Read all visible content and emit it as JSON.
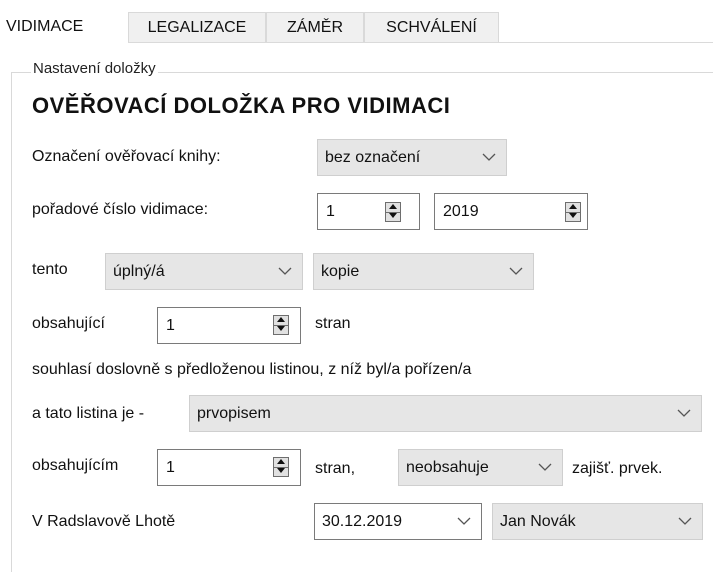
{
  "tabs": [
    {
      "label": "VIDIMACE",
      "active": true
    },
    {
      "label": "LEGALIZACE",
      "active": false
    },
    {
      "label": "ZÁMĚR",
      "active": false
    },
    {
      "label": "SCHVÁLENÍ",
      "active": false
    }
  ],
  "group_label": "Nastavení doložky",
  "heading": "OVĚŘOVACÍ DOLOŽKA PRO VIDIMACI",
  "row1": {
    "label": "Označení ověřovací knihy:",
    "value": "bez označení"
  },
  "row2": {
    "label": "pořadové číslo vidimace:",
    "number": "1",
    "year": "2019"
  },
  "row3": {
    "label": "tento",
    "completeness": "úplný/á",
    "doc_type": "kopie"
  },
  "row4": {
    "label": "obsahující",
    "pages": "1",
    "suffix": "stran"
  },
  "row5": {
    "text": "souhlasí doslovně s předloženou listinou, z níž byl/a pořízen/a"
  },
  "row6": {
    "label": "a tato listina je -",
    "value": "prvopisem"
  },
  "row7": {
    "label": "obsahujícím",
    "pages": "1",
    "suffix": "stran,",
    "security": "neobsahuje",
    "security_suffix": "zajišť. prvek."
  },
  "row8": {
    "place": "V Radslavově Lhotě",
    "date": "30.12.2019",
    "person": "Jan Novák"
  },
  "colors": {
    "tab_bg": "#f0f0f0",
    "combo_bg": "#e6e6e6",
    "border": "#7a7a7a"
  }
}
